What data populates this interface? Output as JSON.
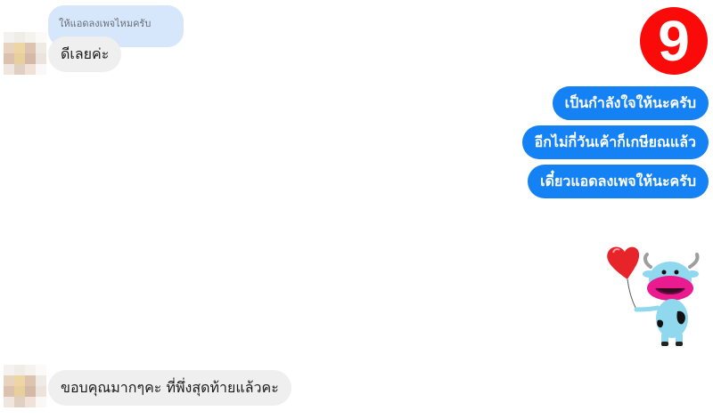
{
  "badge": {
    "number": "9",
    "color": "#fb0a0a"
  },
  "reply_preview": {
    "text": "ให้แอดลงเพจไหมครับ"
  },
  "messages": {
    "incoming_1": "ดีเลยค่ะ",
    "outgoing_1": "เป็นกำลังใจให้นะครับ",
    "outgoing_2": "อีกไม่กี่วันเค้าก็เกษียณแล้ว",
    "outgoing_3": "เดี๋ยวแอดลงเพจให้นะครับ",
    "incoming_2": "ขอบคุณมากๆคะ ที่พึ่งสุดท้ายแล้วคะ"
  },
  "sticker": {
    "name": "cow-with-heart-balloon-sticker"
  },
  "colors": {
    "outgoing_bubble": "#1481f5",
    "incoming_bubble": "#efefef",
    "reply_bubble": "#d6e6fb"
  }
}
